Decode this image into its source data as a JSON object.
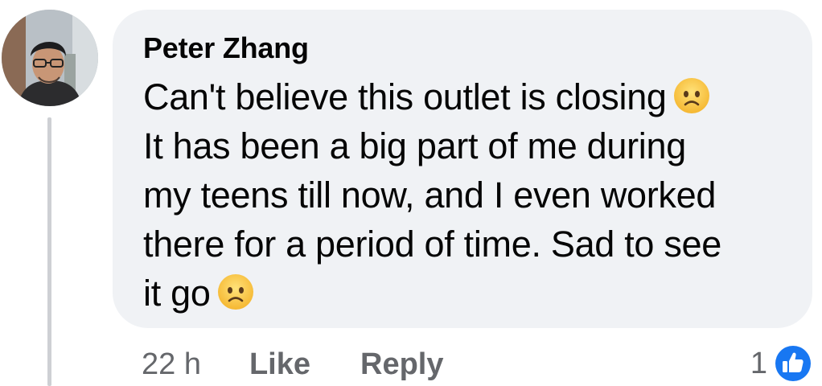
{
  "comment": {
    "author": "Peter Zhang",
    "text_lines": [
      "Can't believe this outlet is closing",
      "It has been a big part of me during",
      "my teens till now, and I even worked",
      "there for a period of time. Sad to see",
      "it go"
    ],
    "emoji": "frowning-face-emoji",
    "timestamp": "22 h",
    "like_label": "Like",
    "reply_label": "Reply",
    "reaction_count": "1",
    "reaction_icon": "like-reaction-icon"
  },
  "colors": {
    "bubble_bg": "#f0f2f5",
    "text": "#050505",
    "meta": "#65676b",
    "like_blue": "#1877f2",
    "thread_line": "#ced0d4"
  }
}
